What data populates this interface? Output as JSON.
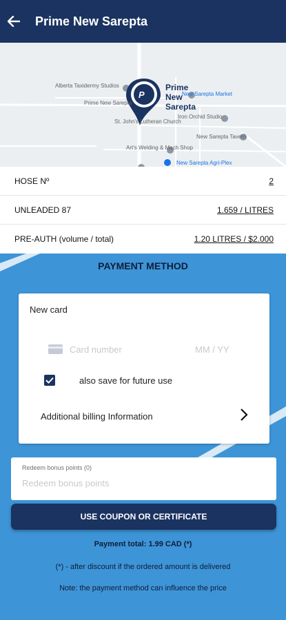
{
  "header": {
    "title": "Prime New Sarepta",
    "back_icon": "arrow-left-icon",
    "background": "#1b3360"
  },
  "map": {
    "station_name": "Prime New Sarepta",
    "station_lines": [
      "Prime",
      "New",
      "Sarepta"
    ],
    "places": [
      "Alberta Taxidermy Studios",
      "Prime New Sarepta",
      "New Sarepta Market",
      "Iron Orchid Studio",
      "St. John's Lutheran Church",
      "New Sarepta Tavern",
      "Art's Welding & Mach Shop",
      "New Sarepta Agri-Plex"
    ]
  },
  "fuel_info": {
    "rows": [
      {
        "label": "HOSE Nº",
        "value": "2"
      },
      {
        "label": "UNLEADED 87",
        "value": "1.659 / LITRES"
      },
      {
        "label": "PRE-AUTH (volume / total)",
        "value": "1.20 LITRES / $2.000"
      }
    ]
  },
  "payment": {
    "title": "PAYMENT METHOD",
    "card_label": "New card",
    "card_number_placeholder": "Card number",
    "expiry_placeholder": "MM / YY",
    "save_checked": true,
    "save_label": "also save for future use",
    "billing_label": "Additional billing Information",
    "bonus_label": "Redeem bonus points (0)",
    "bonus_placeholder": "Redeem bonus points",
    "coupon_button": "USE COUPON OR CERTIFICATE",
    "total_text": "Payment total: 1.99 CAD (*)",
    "note_discount": "(*) - after discount if the ordered amount is delivered",
    "note_price": "Note: the payment method can influence the price"
  },
  "colors": {
    "accent": "#1b3360",
    "background_blue": "#3d94d6"
  }
}
